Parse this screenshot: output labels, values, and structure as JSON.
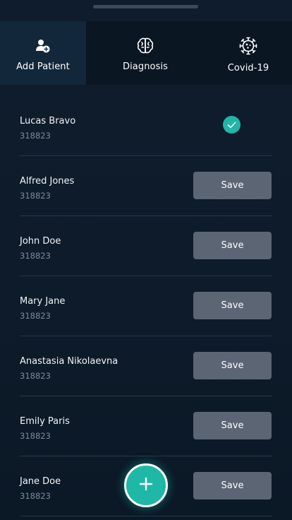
{
  "tabs": [
    {
      "label": "Add Patient",
      "icon": "add-user-icon",
      "active": true
    },
    {
      "label": "Diagnosis",
      "icon": "brain-icon",
      "active": false
    },
    {
      "label": "Covid-19",
      "icon": "virus-icon",
      "active": false
    }
  ],
  "patients": [
    {
      "name": "Lucas Bravo",
      "id": "318823",
      "saved": true
    },
    {
      "name": "Alfred Jones",
      "id": "318823",
      "saved": false,
      "action": "Save"
    },
    {
      "name": "John Doe",
      "id": "318823",
      "saved": false,
      "action": "Save"
    },
    {
      "name": "Mary Jane",
      "id": "318823",
      "saved": false,
      "action": "Save"
    },
    {
      "name": "Anastasia Nikolaevna",
      "id": "318823",
      "saved": false,
      "action": "Save"
    },
    {
      "name": "Emily Paris",
      "id": "318823",
      "saved": false,
      "action": "Save"
    },
    {
      "name": "Jane Doe",
      "id": "318823",
      "saved": false,
      "action": "Save"
    }
  ],
  "fab": {
    "icon": "plus-icon"
  },
  "colors": {
    "background": "#0d1b2a",
    "active_tab": "#13273a",
    "accent": "#22b6a8",
    "save_button": "#5b6573"
  }
}
